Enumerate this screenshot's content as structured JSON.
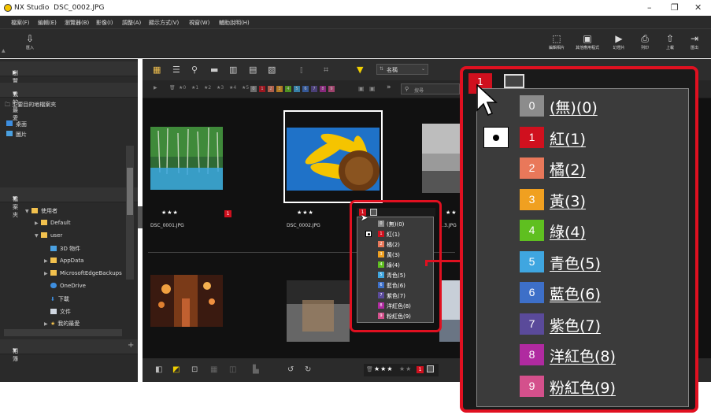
{
  "window": {
    "app": "NX Studio",
    "file": "DSC_0002.JPG",
    "controls": [
      "–",
      "❐",
      "✕"
    ]
  },
  "menu": [
    "檔案(F)",
    "編輯(E)",
    "瀏覽器(B)",
    "影像(I)",
    "調整(A)",
    "顯示方式(V)",
    "視窗(W)",
    "輔助說明(H)"
  ],
  "toolbar": {
    "import": "匯入",
    "right": [
      {
        "label": "編輯相片",
        "icon": "edit-photo-icon"
      },
      {
        "label": "其他應用程式",
        "icon": "app-icon"
      },
      {
        "label": "幻燈片",
        "icon": "slideshow-icon"
      },
      {
        "label": "列印",
        "icon": "print-icon"
      },
      {
        "label": "上載",
        "icon": "upload-icon"
      },
      {
        "label": "匯出",
        "icon": "export-icon"
      }
    ]
  },
  "left": {
    "browse": "瀏覽",
    "favorites": "我的最愛",
    "fav_items": [
      "主要目的地檔案夾",
      "桌面",
      "圖片"
    ],
    "folders": "檔案夾",
    "tree": [
      {
        "label": "使用者",
        "indent": 0
      },
      {
        "label": "Default",
        "indent": 1
      },
      {
        "label": "user",
        "indent": 1
      },
      {
        "label": "3D 物件",
        "indent": 2
      },
      {
        "label": "AppData",
        "indent": 2
      },
      {
        "label": "MicrosoftEdgeBackups",
        "indent": 2
      },
      {
        "label": "OneDrive",
        "indent": 2
      },
      {
        "label": "下載",
        "indent": 2
      },
      {
        "label": "文件",
        "indent": 2
      },
      {
        "label": "我的最愛",
        "indent": 2
      }
    ],
    "albums": "相簿",
    "add": "+"
  },
  "browser": {
    "sort": "名稱",
    "search_placeholder": "搜尋",
    "rating_filters": [
      "★0",
      "★1",
      "★2",
      "★3",
      "★4",
      "★5"
    ],
    "label_numbers": [
      "0",
      "1",
      "2",
      "3",
      "4",
      "5",
      "6",
      "7",
      "8",
      "9"
    ],
    "thumbs": [
      {
        "name": "DSC_0001.JPG",
        "stars": "★★★",
        "label": "1"
      },
      {
        "name": "DSC_0002.JPG",
        "stars": "★★★",
        "label": ""
      },
      {
        "name": "…3.JPG",
        "stars": "★★",
        "label": ""
      }
    ],
    "bottom_rating": "★★★",
    "bottom_rating_empty": "★★",
    "bottom_label": "1"
  },
  "labels": [
    {
      "num": "0",
      "text": "(無)(0)",
      "color": "#8c8c8c"
    },
    {
      "num": "1",
      "text": "紅(1)",
      "color": "#d0101e",
      "selected": true
    },
    {
      "num": "2",
      "text": "橘(2)",
      "color": "#e9785a"
    },
    {
      "num": "3",
      "text": "黃(3)",
      "color": "#f0a020"
    },
    {
      "num": "4",
      "text": "綠(4)",
      "color": "#5fbf20"
    },
    {
      "num": "5",
      "text": "青色(5)",
      "color": "#3fa6e0"
    },
    {
      "num": "6",
      "text": "藍色(6)",
      "color": "#3d6fc8"
    },
    {
      "num": "7",
      "text": "紫色(7)",
      "color": "#5a4a9a"
    },
    {
      "num": "8",
      "text": "洋紅色(8)",
      "color": "#b02aa0"
    },
    {
      "num": "9",
      "text": "粉紅色(9)",
      "color": "#d4508c"
    }
  ],
  "current_label": "1"
}
